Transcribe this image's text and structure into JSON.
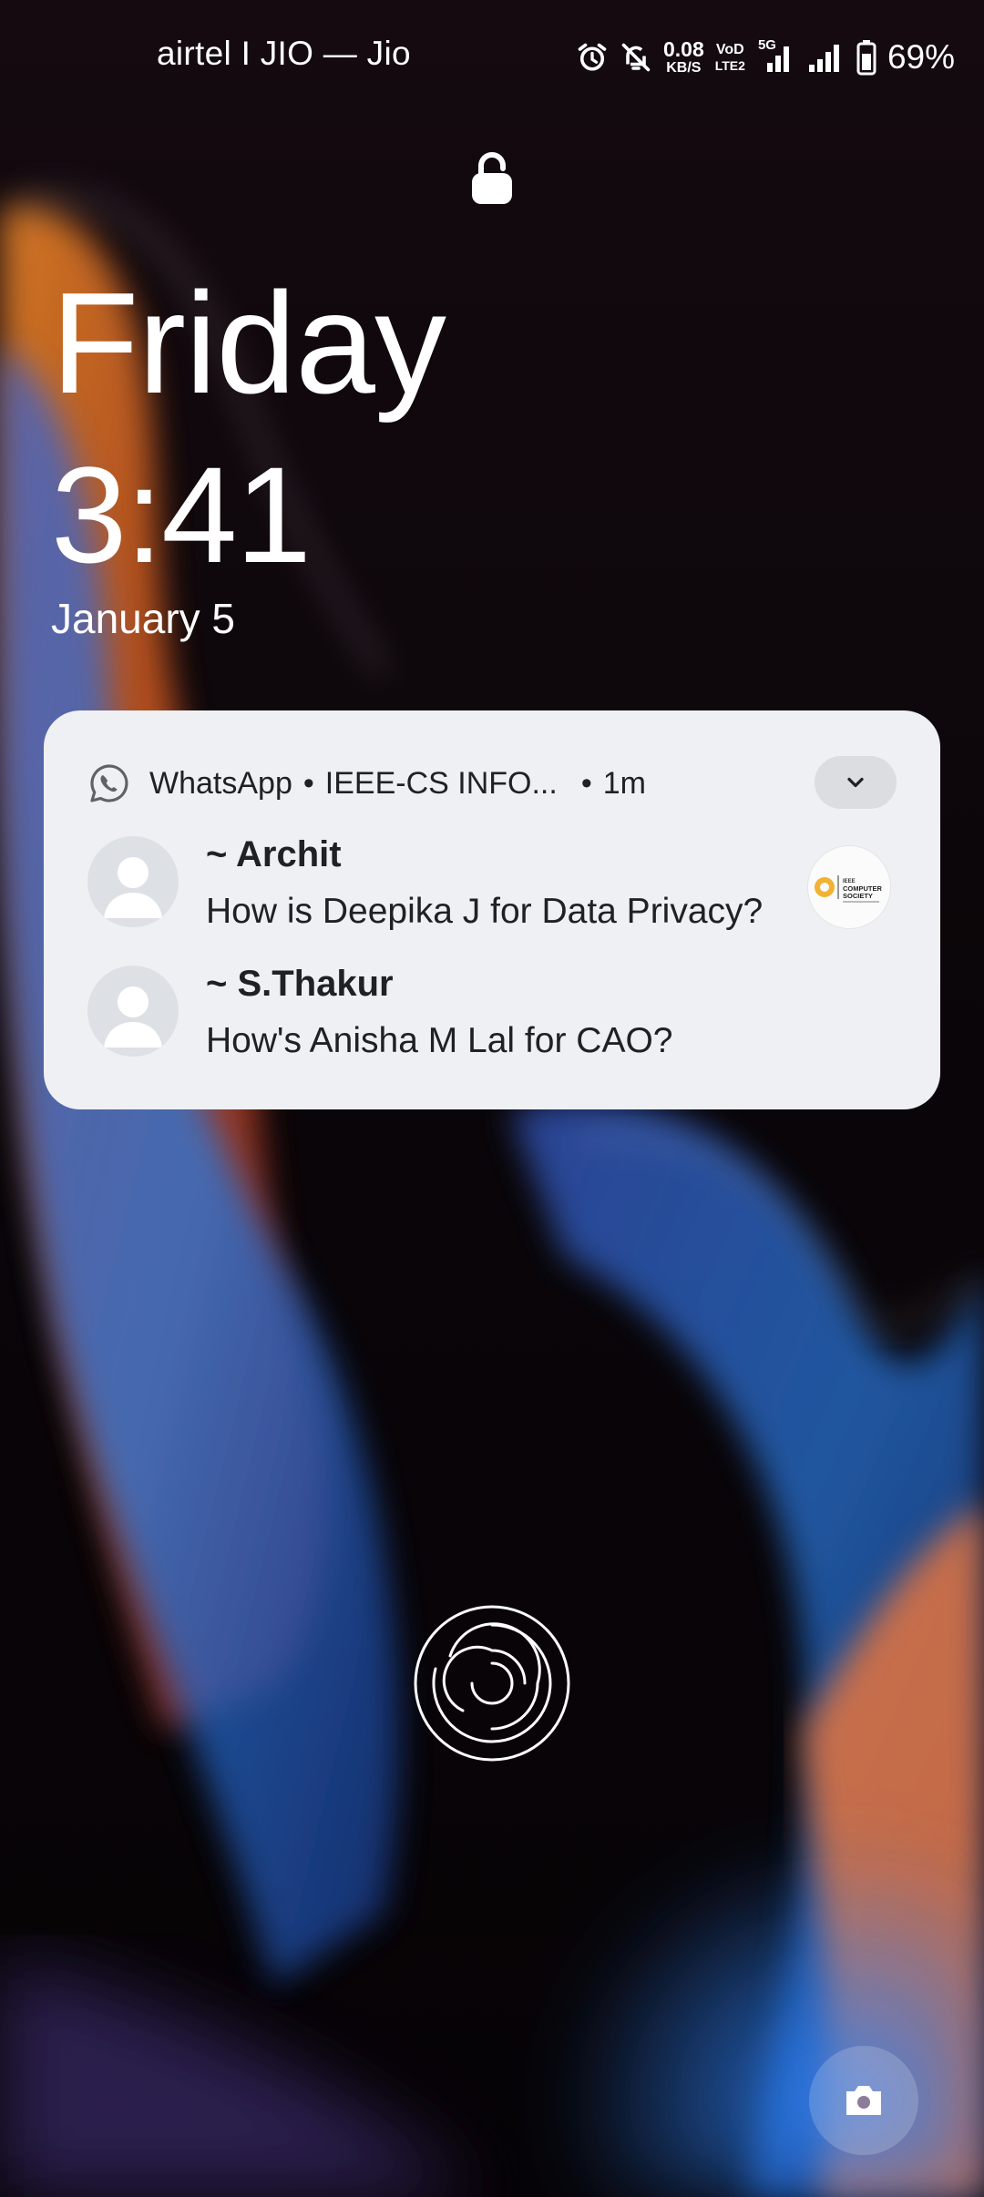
{
  "status_bar": {
    "carrier": "airtel I JIO — Jio",
    "net_speed_value": "0.08",
    "net_speed_unit": "KB/S",
    "volte_top": "VoD",
    "volte_bottom": "LTE2",
    "network_type": "5G",
    "battery_percent": "69%",
    "icons": [
      "alarm-icon",
      "mute-icon",
      "signal-icon",
      "signal-icon",
      "battery-icon"
    ]
  },
  "lock_screen": {
    "day": "Friday",
    "time": "3:41",
    "date": "January 5"
  },
  "notification": {
    "app": "WhatsApp",
    "group": "IEEE-CS INFO...",
    "time": "1m",
    "separator": "•",
    "messages": [
      {
        "sender": "~ Archit",
        "text": "How is Deepika J for Data Privacy?"
      },
      {
        "sender": "~ S.Thakur",
        "text": "How's Anisha M Lal for CAO?"
      }
    ],
    "group_logo_text": "IEEE COMPUTER SOCIETY",
    "card_background": "#eff0f4"
  },
  "controls": {
    "fingerprint_icon": "fingerprint-icon",
    "camera_icon": "camera-icon"
  }
}
